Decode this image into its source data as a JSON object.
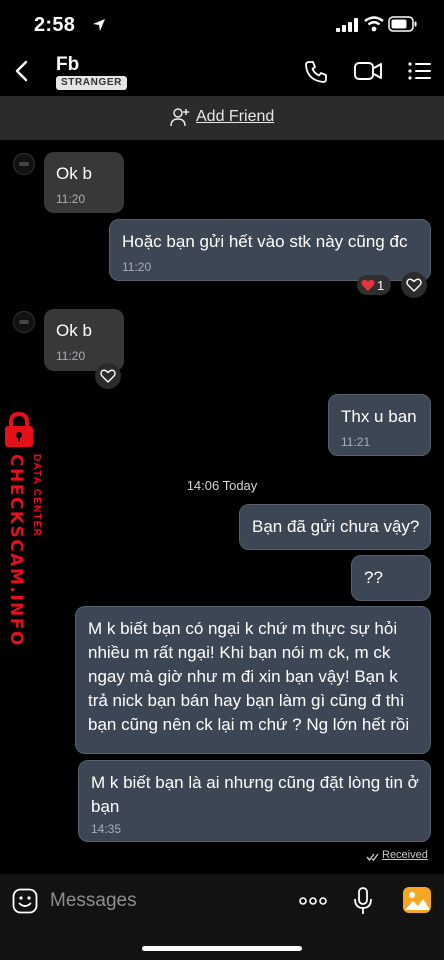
{
  "status_bar": {
    "time": "2:58"
  },
  "header": {
    "contact_name": "Fb",
    "badge": "STRANGER"
  },
  "add_friend": {
    "label": "Add Friend"
  },
  "messages": [
    {
      "text": "Ok b",
      "time": "11:20",
      "direction": "incoming"
    },
    {
      "text": "Hoặc bạn gửi hết vào stk này cũng đc",
      "time": "11:20",
      "direction": "outgoing",
      "reaction_count": "1"
    },
    {
      "text": "Ok b",
      "time": "11:20",
      "direction": "incoming"
    },
    {
      "text": "Thx u ban",
      "time": "11:21",
      "direction": "outgoing"
    },
    {
      "text": "Bạn đã gửi chưa vậy?",
      "direction": "outgoing"
    },
    {
      "text": "??",
      "direction": "outgoing"
    },
    {
      "text": "M k biết bạn có ngại k chứ m thực sự hỏi nhiều m rất ngại! Khi bạn nói m ck, m ck ngay mà giờ như m đi xin bạn vậy! Bạn k trả nick bạn bán hay bạn làm gì cũng đ thì bạn cũng nên ck lại m chứ ? Ng lớn hết rồi",
      "direction": "outgoing"
    },
    {
      "text": "M k biết bạn là ai nhưng cũng đặt lòng tin ở bạn",
      "time": "14:35",
      "direction": "outgoing"
    }
  ],
  "day_separator": "14:06 Today",
  "receipt": "Received",
  "watermark": {
    "main": "CHECKSCAM.INFO",
    "sub": "DATA CENTER"
  },
  "composer": {
    "placeholder": "Messages"
  },
  "colors": {
    "outgoing_bubble": "#3c4654",
    "incoming_bubble": "#383838",
    "watermark": "#e5101a",
    "photo_icon": "#f5a623"
  }
}
